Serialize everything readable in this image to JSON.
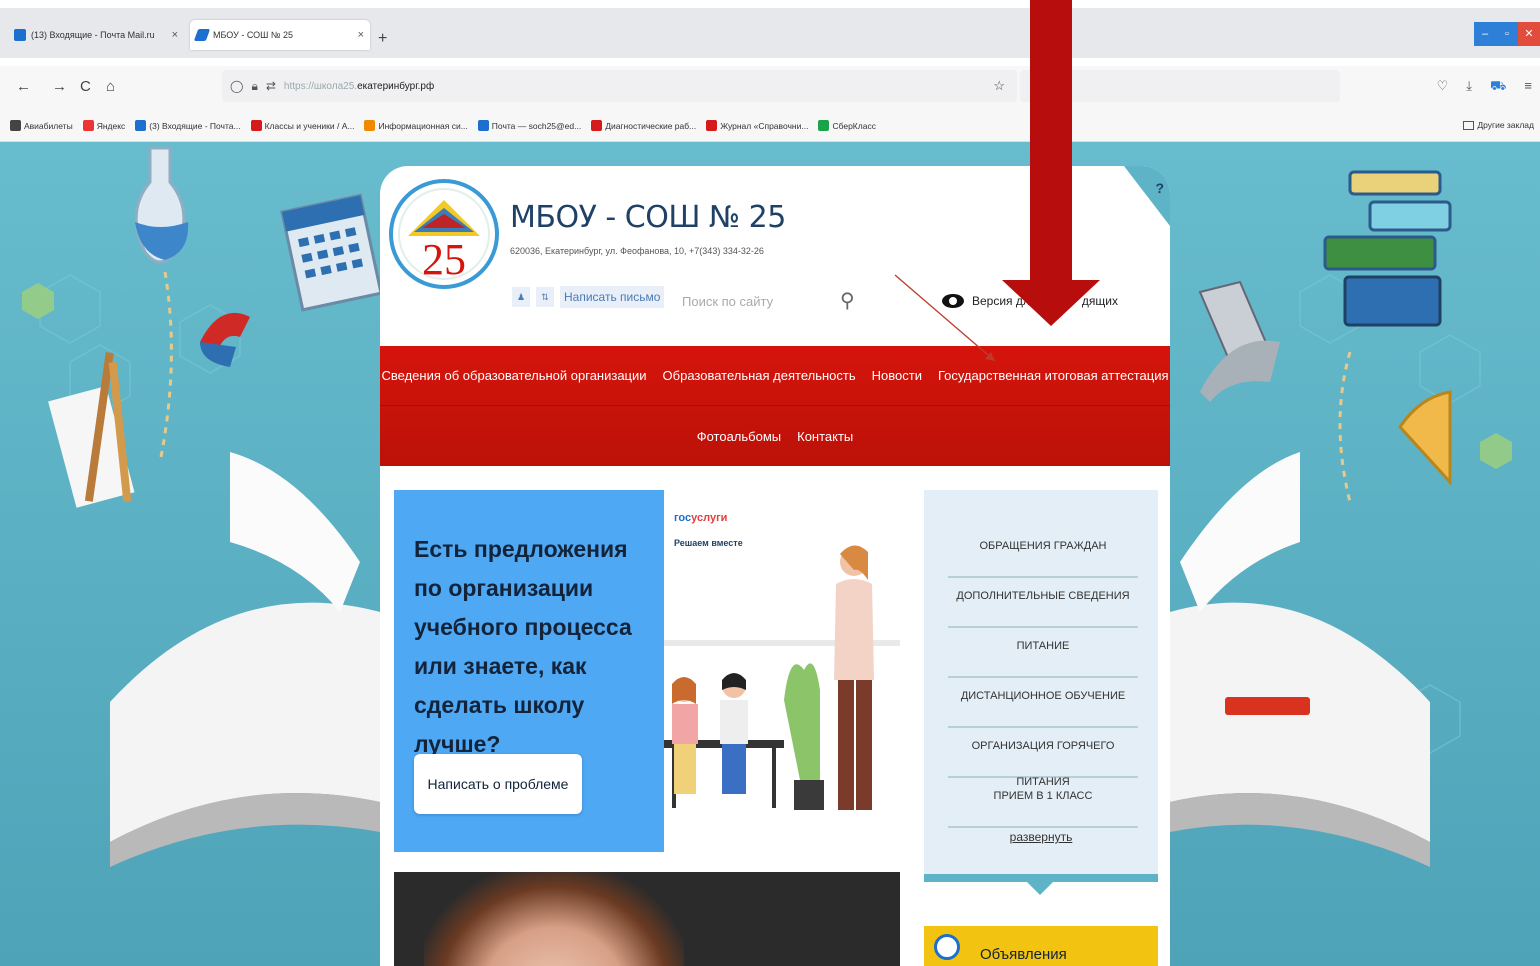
{
  "browser": {
    "tabs": [
      {
        "title": "(13) Входящие - Почта Mail.ru",
        "close": "×",
        "icon": "mail-icon",
        "color": "#1c6ecf"
      },
      {
        "title": "МБОУ - СОШ № 25",
        "close": "×",
        "icon": "pen-icon",
        "color": "#1c6ecf"
      }
    ],
    "new_tab": "+",
    "window_controls": [
      "–",
      "▫",
      "✕"
    ],
    "nav": {
      "back": "←",
      "forward": "→",
      "reload": "C",
      "home": "⌂"
    },
    "url": {
      "host": "https://школа25.",
      "path": "екатеринбург.рф"
    },
    "bookmarks": [
      {
        "label": "Авиабилеты",
        "color": "#444"
      },
      {
        "label": "Яндекс",
        "color": "#e33"
      },
      {
        "label": "(3) Входящие - Почта...",
        "color": "#1c6ecf"
      },
      {
        "label": "Классы и ученики / А...",
        "color": "#d41a1a"
      },
      {
        "label": "Информационная си...",
        "color": "#f08a00"
      },
      {
        "label": "Почта — soch25@ed...",
        "color": "#1c6ecf"
      },
      {
        "label": "Диагностические раб...",
        "color": "#d41a1a"
      },
      {
        "label": "Журнал «Справочни...",
        "color": "#d41a1a"
      },
      {
        "label": "СберКласс",
        "color": "#1aa34a"
      }
    ],
    "other_bookmarks": "Другие заклад"
  },
  "site": {
    "title": "МБОУ - СОШ № 25",
    "address": "620036, Екатеринбург, ул. Феофанова, 10,     +7(343) 334-32-26",
    "write_letter": "Написать письмо",
    "search_placeholder": "Поиск по сайту",
    "vision": "Версия для слабовидящих",
    "vision_visible": "Версия дл",
    "vision_end": "дящих",
    "help": "?",
    "logo_number": "25",
    "menu_row1": [
      "Сведения об образовательной организации",
      "Образовательная деятельность",
      "Новости",
      "Государственная итоговая аттестация"
    ],
    "menu_row2": [
      "Фотоальбомы",
      "Контакты"
    ],
    "banner": {
      "text": "Есть предложения по организации учебного процесса или знаете, как сделать школу лучше?",
      "button": "Написать о проблеме",
      "gos_a": "гос",
      "gos_b": "услуги",
      "gos_sub": "Решаем вместе"
    },
    "sidebar": {
      "links": [
        "ОБРАЩЕНИЯ ГРАЖДАН",
        "ДОПОЛНИТЕЛЬНЫЕ СВЕДЕНИЯ",
        "ПИТАНИЕ",
        "ДИСТАНЦИОННОЕ ОБУЧЕНИЕ",
        "ОРГАНИЗАЦИЯ ГОРЯЧЕГО ПИТАНИЯ",
        "ПРИЕМ В 1 КЛАСС"
      ],
      "expand": "развернуть"
    },
    "announcements": "Объявления"
  },
  "colors": {
    "menu_red": "#d5140c",
    "page_bg": "#5eb3c6",
    "arrow": "#b80d0d",
    "banner_blue": "#4ea8f4",
    "announce_yellow": "#f2c311"
  }
}
